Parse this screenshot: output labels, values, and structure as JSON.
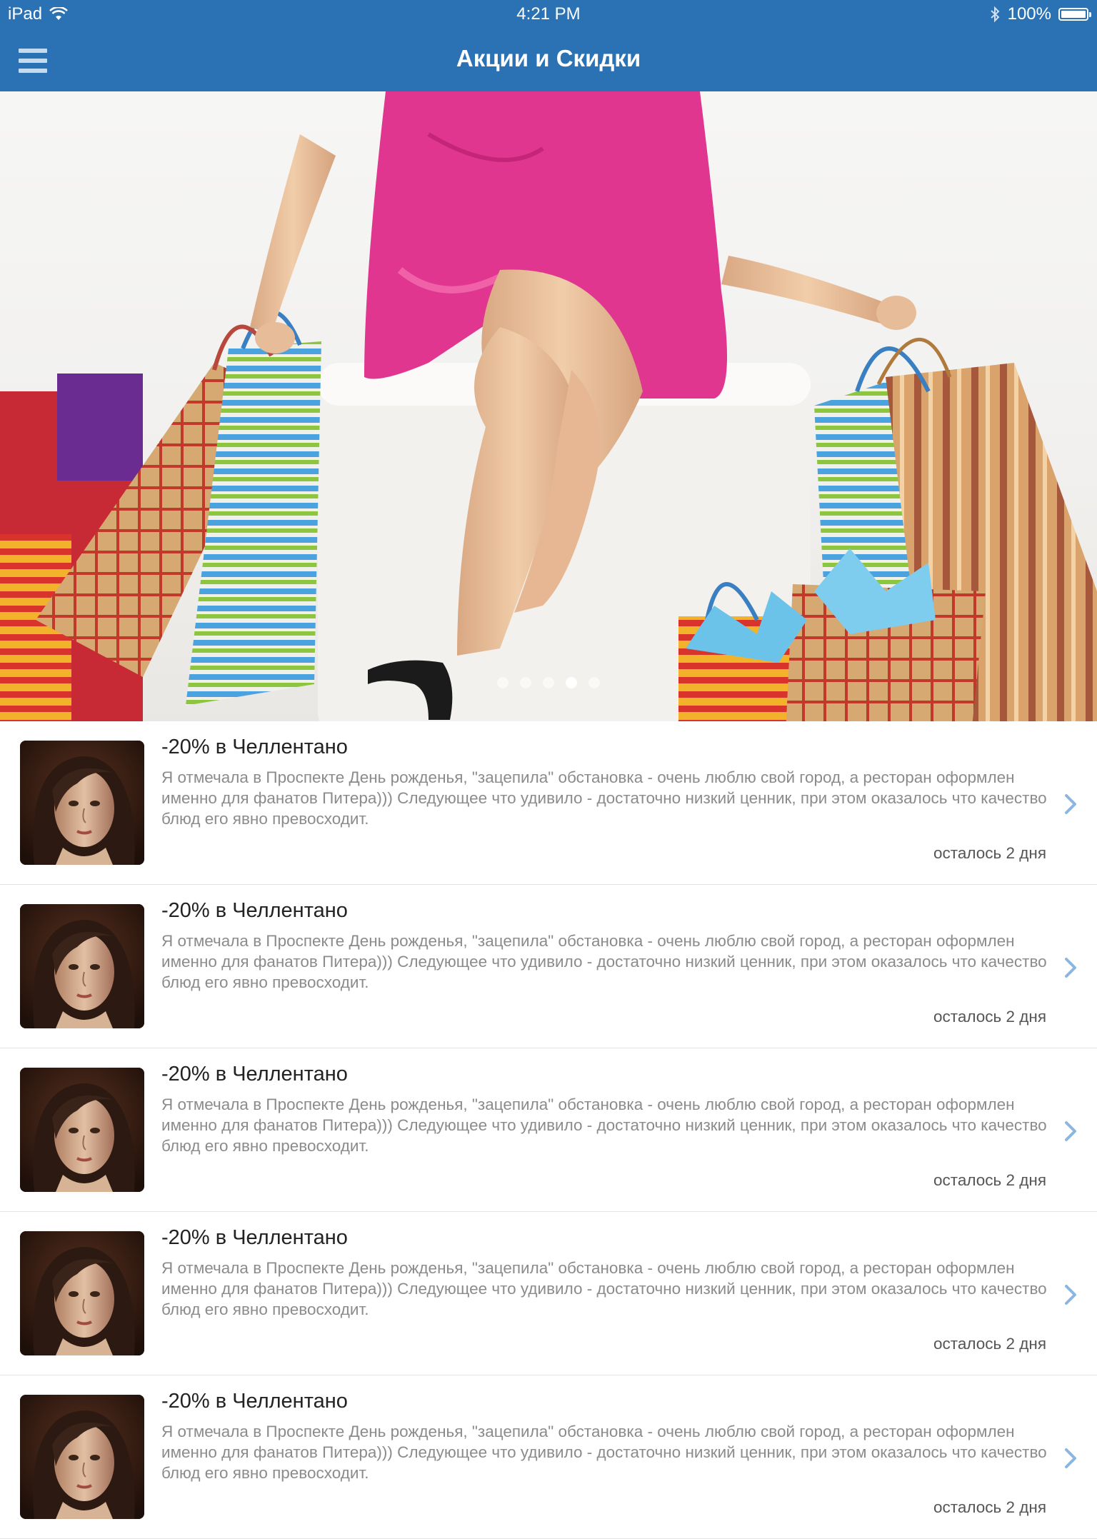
{
  "status_bar": {
    "device": "iPad",
    "time": "4:21 PM",
    "battery_text": "100%",
    "battery_level": 1.0
  },
  "nav": {
    "title": "Акции и Скидки"
  },
  "carousel": {
    "page_count": 5,
    "active_page": 4
  },
  "colors": {
    "accent": "#2a72b4",
    "chevron": "#8cb6e0",
    "dress": "#e0368f"
  },
  "items": [
    {
      "title": "-20% в Челлентано",
      "description": "Я отмечала в Проспекте День рожденья, \"зацепила\" обстановка - очень люблю свой город, а ресторан оформлен именно для фанатов Питера))) Следующее что удивило - достаточно низкий ценник, при этом оказалось что качество блюд его явно превосходит.",
      "remaining": "осталось 2 дня"
    },
    {
      "title": "-20% в Челлентано",
      "description": "Я отмечала в Проспекте День рожденья, \"зацепила\" обстановка - очень люблю свой город, а ресторан оформлен именно для фанатов Питера))) Следующее что удивило - достаточно низкий ценник, при этом оказалось что качество блюд его явно превосходит.",
      "remaining": "осталось 2 дня"
    },
    {
      "title": "-20% в Челлентано",
      "description": "Я отмечала в Проспекте День рожденья, \"зацепила\" обстановка - очень люблю свой город, а ресторан оформлен именно для фанатов Питера))) Следующее что удивило - достаточно низкий ценник, при этом оказалось что качество блюд его явно превосходит.",
      "remaining": "осталось 2 дня"
    },
    {
      "title": "-20% в Челлентано",
      "description": "Я отмечала в Проспекте День рожденья, \"зацепила\" обстановка - очень люблю свой город, а ресторан оформлен именно для фанатов Питера))) Следующее что удивило - достаточно низкий ценник, при этом оказалось что качество блюд его явно превосходит.",
      "remaining": "осталось 2 дня"
    },
    {
      "title": "-20% в Челлентано",
      "description": "Я отмечала в Проспекте День рожденья, \"зацепила\" обстановка - очень люблю свой город, а ресторан оформлен именно для фанатов Питера))) Следующее что удивило - достаточно низкий ценник, при этом оказалось что качество блюд его явно превосходит.",
      "remaining": "осталось 2 дня"
    }
  ]
}
